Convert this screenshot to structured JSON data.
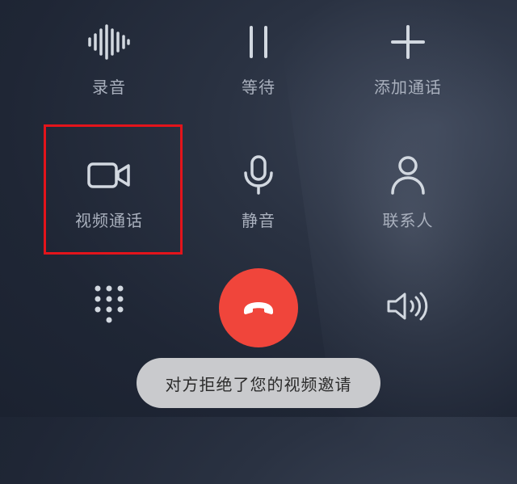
{
  "controls": {
    "record": {
      "label": "录音",
      "icon": "waveform-icon"
    },
    "hold": {
      "label": "等待",
      "icon": "pause-icon"
    },
    "add_call": {
      "label": "添加通话",
      "icon": "plus-icon"
    },
    "video_call": {
      "label": "视频通话",
      "icon": "video-camera-icon"
    },
    "mute": {
      "label": "静音",
      "icon": "microphone-icon"
    },
    "contacts": {
      "label": "联系人",
      "icon": "person-icon"
    }
  },
  "bottom": {
    "keypad_icon": "dialpad-icon",
    "hangup_icon": "phone-hangup-icon",
    "speaker_icon": "speaker-icon"
  },
  "toast": {
    "text": "对方拒绝了您的视频邀请"
  },
  "colors": {
    "hangup": "#f0453b",
    "highlight": "#e3141b",
    "icon": "#cfd5de",
    "label": "#a9b0bd"
  }
}
